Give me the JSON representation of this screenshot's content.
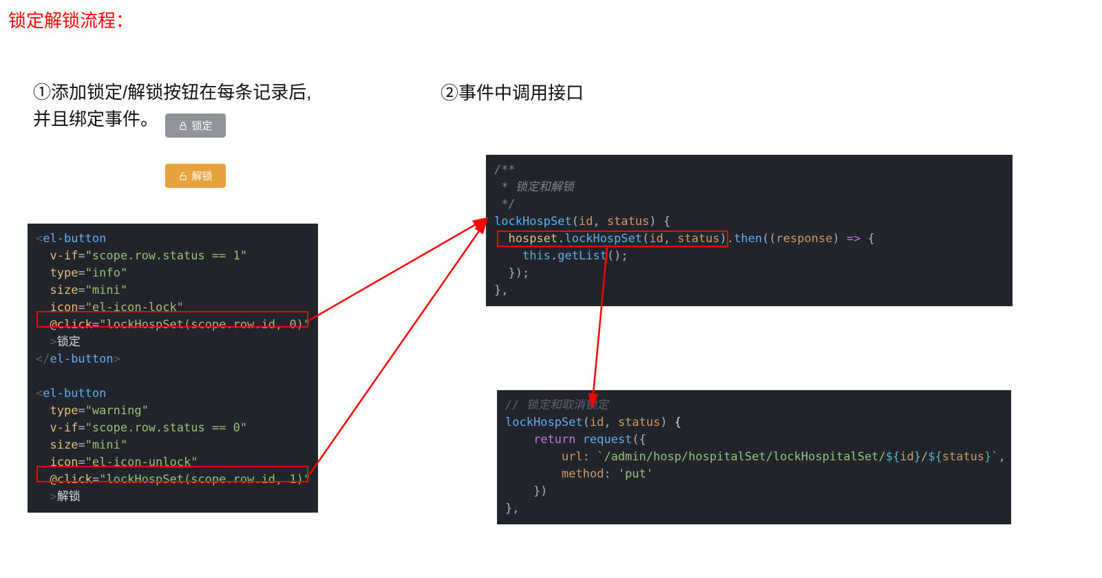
{
  "title": "锁定解锁流程：",
  "step1": "①添加锁定/解锁按钮在每条记录后,并且绑定事件。",
  "step2": "②事件中调用接口",
  "btnLock": "锁定",
  "btnUnlock": "解锁",
  "code1": "<el-button\n  v-if=\"scope.row.status == 1\"\n  type=\"info\"\n  size=\"mini\"\n  icon=\"el-icon-lock\"\n  @click=\"lockHospSet(scope.row.id, 0)\"\n  >锁定\n</el-button>\n\n<el-button\n  type=\"warning\"\n  v-if=\"scope.row.status == 0\"\n  size=\"mini\"\n  icon=\"el-icon-unlock\"\n  @click=\"lockHospSet(scope.row.id, 1)\"\n  >解锁",
  "code2": "/**\n * 锁定和解锁\n */\nlockHospSet(id, status) {\n  hospset.lockHospSet(id, status).then((response) => {\n    this.getList();\n  });\n},",
  "code3": "// 锁定和取消锁定\nlockHospSet(id, status) {\n    return request({\n        url: `/admin/hosp/hospitalSet/lockHospitalSet/${id}/${status}`,\n        method: 'put'\n    })\n},"
}
